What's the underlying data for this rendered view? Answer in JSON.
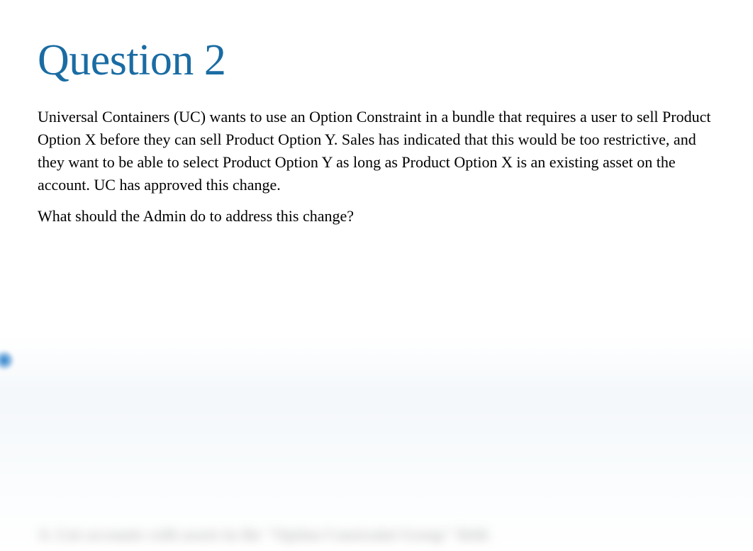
{
  "heading": "Question 2",
  "paragraph1": " Universal Containers (UC) wants to use an Option Constraint in a bundle that requires a user to sell Product Option X before they can sell Product Option Y. Sales has indicated that this would be too restrictive, and they want to be able to select Product Option Y as long as Product Option X is an existing asset on the account. UC has approved this change.",
  "paragraph2": "What should the Admin do to address this change?",
  "blurredHint": "A. List accounts with assets in the \"Option Constraint Group\" field."
}
